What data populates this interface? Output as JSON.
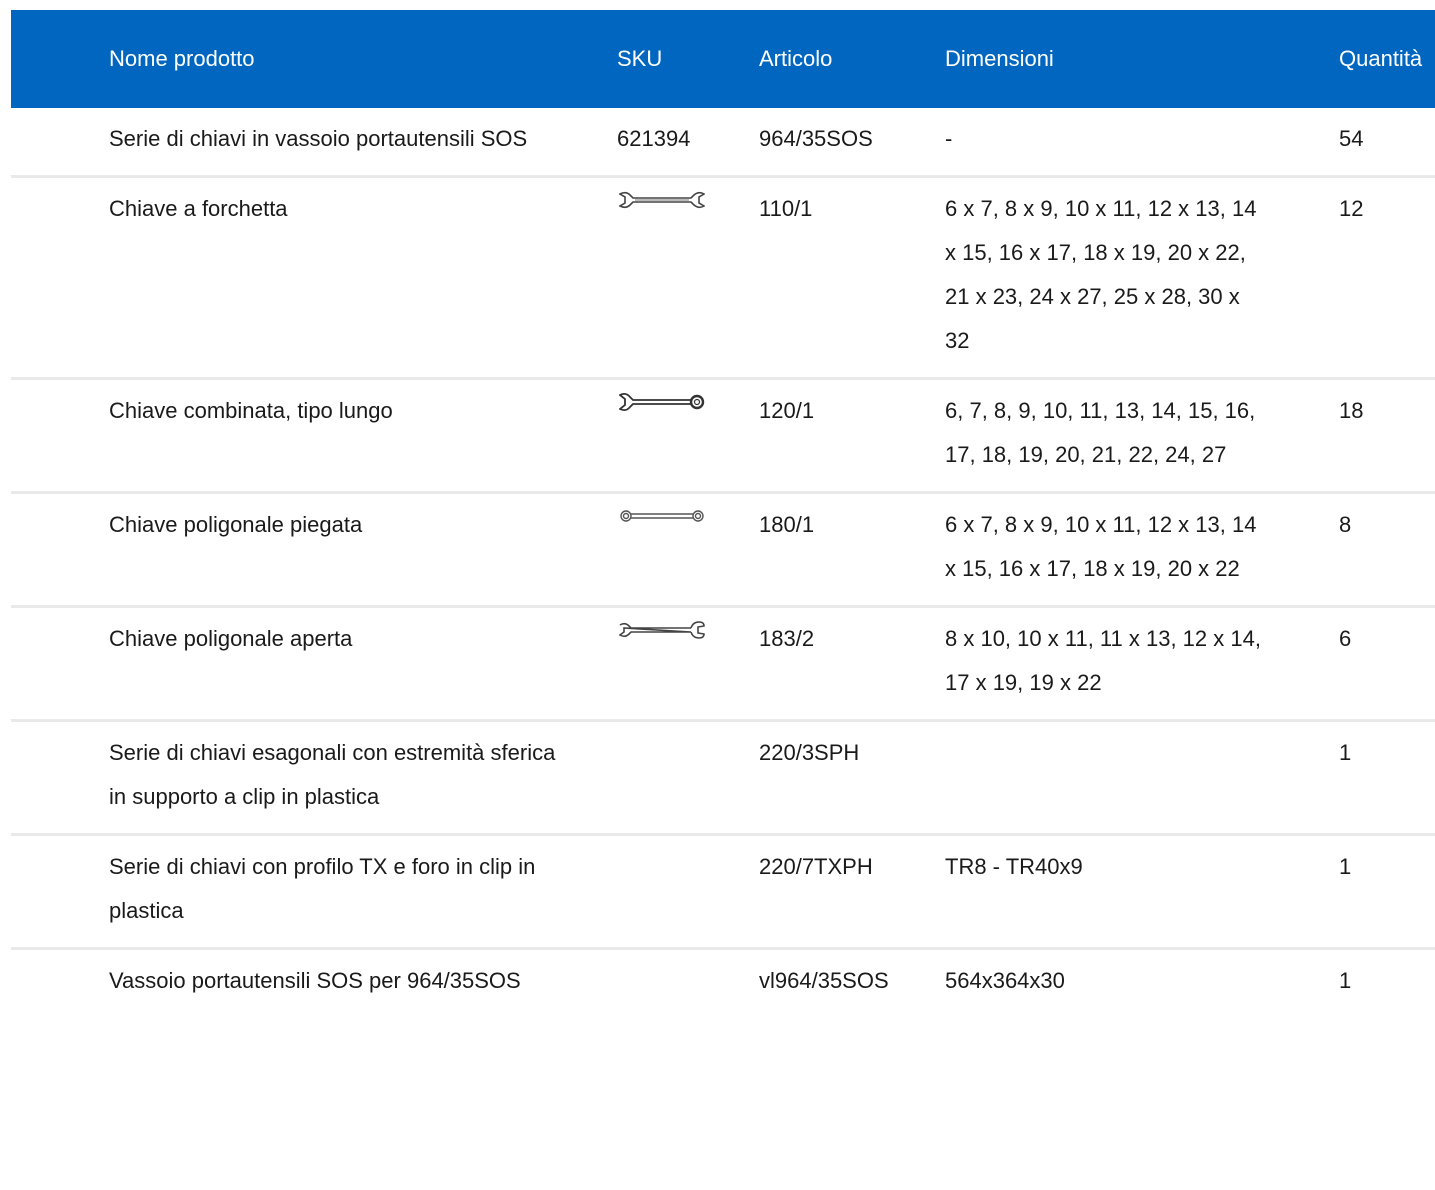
{
  "table": {
    "headers": {
      "name": "Nome prodotto",
      "sku": "SKU",
      "article": "Articolo",
      "dimensions": "Dimensioni",
      "quantity": "Quantità"
    },
    "rows": [
      {
        "name": "Serie di chiavi in vassoio portautensili SOS",
        "sku": "621394",
        "sku_icon": "",
        "article": "964/35SOS",
        "dimensions": "-",
        "quantity": "54"
      },
      {
        "name": "Chiave a forchetta",
        "sku": "",
        "sku_icon": "open-end-wrench-icon",
        "article": "110/1",
        "dimensions": "6 x 7, 8 x 9, 10 x 11, 12 x 13, 14 x 15, 16 x 17, 18 x 19, 20 x 22, 21 x 23, 24 x 27, 25 x 28, 30 x 32",
        "quantity": "12"
      },
      {
        "name": "Chiave combinata, tipo lungo",
        "sku": "",
        "sku_icon": "combination-wrench-icon",
        "article": "120/1",
        "dimensions": "6, 7, 8, 9, 10, 11, 13, 14, 15, 16, 17, 18, 19, 20, 21, 22, 24, 27",
        "quantity": "18"
      },
      {
        "name": "Chiave poligonale piegata",
        "sku": "",
        "sku_icon": "ring-wrench-icon",
        "article": "180/1",
        "dimensions": "6 x 7, 8 x 9, 10 x 11, 12 x 13, 14 x 15, 16 x 17, 18 x 19, 20 x 22",
        "quantity": "8"
      },
      {
        "name": "Chiave poligonale aperta",
        "sku": "",
        "sku_icon": "flare-nut-wrench-icon",
        "article": "183/2",
        "dimensions": "8 x 10, 10 x 11, 11 x 13, 12 x 14, 17 x 19, 19 x 22",
        "quantity": "6"
      },
      {
        "name": "Serie di chiavi esagonali con estremità sferica in supporto a clip in plastica",
        "sku": "",
        "sku_icon": "",
        "article": "220/3SPH",
        "dimensions": "",
        "quantity": "1"
      },
      {
        "name": "Serie di chiavi con profilo TX e foro in clip in plastica",
        "sku": "",
        "sku_icon": "",
        "article": "220/7TXPH",
        "dimensions": "TR8 - TR40x9",
        "quantity": "1"
      },
      {
        "name": "Vassoio portautensili SOS per 964/35SOS",
        "sku": "",
        "sku_icon": "",
        "article": "vl964/35SOS",
        "dimensions": "564x364x30",
        "quantity": "1"
      }
    ]
  },
  "colors": {
    "header_bg": "#0066c0",
    "header_text": "#ffffff",
    "row_divider": "#e9e9e9"
  }
}
